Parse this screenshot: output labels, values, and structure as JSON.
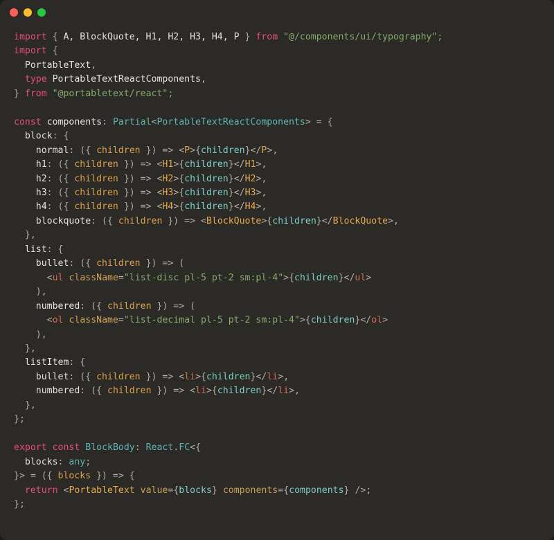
{
  "titlebar": {
    "title": ""
  },
  "code": {
    "line1": {
      "import": "import",
      "lbrace": " { ",
      "items": "A, BlockQuote, H1, H2, H3, H4, P",
      "rbrace": " } ",
      "from": "from",
      "q1": " \"",
      "mod": "@/components/ui/typography",
      "q2": "\";"
    },
    "line2": {
      "import": "import",
      "lbrace": " {"
    },
    "line3": {
      "indent": "  ",
      "name": "PortableText",
      "comma": ","
    },
    "line4": {
      "indent": "  ",
      "typekw": "type",
      "sp": " ",
      "name": "PortableTextReactComponents",
      "comma": ","
    },
    "line5": {
      "rbrace": "} ",
      "from": "from",
      "q1": " \"",
      "mod": "@portabletext/react",
      "q2": "\";"
    },
    "blank1": "",
    "line6": {
      "const": "const",
      "sp": " ",
      "name": "components",
      "colon": ": ",
      "typefn": "Partial",
      "lt": "<",
      "tparam": "PortableTextReactComponents",
      "gt": ">",
      "eq": " = {",
      "end": ""
    },
    "line7": {
      "indent": "  ",
      "key": "block",
      "colon": ": {"
    },
    "line8": {
      "indent": "    ",
      "key": "normal",
      "pre": ": ({ ",
      "param": "children",
      "post": " }) => ",
      "lt": "<",
      "tag": "P",
      "gt": ">",
      "lbrace": "{",
      "expr": "children",
      "rbrace": "}",
      "clt": "</",
      "ctag": "P",
      "cgt": ">",
      "comma": ","
    },
    "line9": {
      "indent": "    ",
      "key": "h1",
      "pre": ": ({ ",
      "param": "children",
      "post": " }) => ",
      "lt": "<",
      "tag": "H1",
      "gt": ">",
      "lbrace": "{",
      "expr": "children",
      "rbrace": "}",
      "clt": "</",
      "ctag": "H1",
      "cgt": ">",
      "comma": ","
    },
    "line10": {
      "indent": "    ",
      "key": "h2",
      "pre": ": ({ ",
      "param": "children",
      "post": " }) => ",
      "lt": "<",
      "tag": "H2",
      "gt": ">",
      "lbrace": "{",
      "expr": "children",
      "rbrace": "}",
      "clt": "</",
      "ctag": "H2",
      "cgt": ">",
      "comma": ","
    },
    "line11": {
      "indent": "    ",
      "key": "h3",
      "pre": ": ({ ",
      "param": "children",
      "post": " }) => ",
      "lt": "<",
      "tag": "H3",
      "gt": ">",
      "lbrace": "{",
      "expr": "children",
      "rbrace": "}",
      "clt": "</",
      "ctag": "H3",
      "cgt": ">",
      "comma": ","
    },
    "line12": {
      "indent": "    ",
      "key": "h4",
      "pre": ": ({ ",
      "param": "children",
      "post": " }) => ",
      "lt": "<",
      "tag": "H4",
      "gt": ">",
      "lbrace": "{",
      "expr": "children",
      "rbrace": "}",
      "clt": "</",
      "ctag": "H4",
      "cgt": ">",
      "comma": ","
    },
    "line13": {
      "indent": "    ",
      "key": "blockquote",
      "pre": ": ({ ",
      "param": "children",
      "post": " }) => ",
      "lt": "<",
      "tag": "BlockQuote",
      "gt": ">",
      "lbrace": "{",
      "expr": "children",
      "rbrace": "}",
      "clt": "</",
      "ctag": "BlockQuote",
      "cgt": ">",
      "comma": ","
    },
    "line14": {
      "indent": "  ",
      "text": "},"
    },
    "line15": {
      "indent": "  ",
      "key": "list",
      "colon": ": {"
    },
    "line16": {
      "indent": "    ",
      "key": "bullet",
      "pre": ": ({ ",
      "param": "children",
      "post": " }) => ("
    },
    "line17": {
      "indent": "      ",
      "lt": "<",
      "tag": "ul",
      "sp": " ",
      "attr": "className",
      "eq": "=",
      "q": "\"",
      "val": "list-disc pl-5 pt-2 sm:pl-4",
      "q2": "\"",
      "gt": ">",
      "lbrace": "{",
      "expr": "children",
      "rbrace": "}",
      "clt": "</",
      "ctag": "ul",
      "cgt": ">"
    },
    "line18": {
      "indent": "    ",
      "text": "),"
    },
    "line19": {
      "indent": "    ",
      "key": "numbered",
      "pre": ": ({ ",
      "param": "children",
      "post": " }) => ("
    },
    "line20": {
      "indent": "      ",
      "lt": "<",
      "tag": "ol",
      "sp": " ",
      "attr": "className",
      "eq": "=",
      "q": "\"",
      "val": "list-decimal pl-5 pt-2 sm:pl-4",
      "q2": "\"",
      "gt": ">",
      "lbrace": "{",
      "expr": "children",
      "rbrace": "}",
      "clt": "</",
      "ctag": "ol",
      "cgt": ">"
    },
    "line21": {
      "indent": "    ",
      "text": "),"
    },
    "line22": {
      "indent": "  ",
      "text": "},"
    },
    "line23": {
      "indent": "  ",
      "key": "listItem",
      "colon": ": {"
    },
    "line24": {
      "indent": "    ",
      "key": "bullet",
      "pre": ": ({ ",
      "param": "children",
      "post": " }) => ",
      "lt": "<",
      "tag": "li",
      "gt": ">",
      "lbrace": "{",
      "expr": "children",
      "rbrace": "}",
      "clt": "</",
      "ctag": "li",
      "cgt": ">",
      "comma": ","
    },
    "line25": {
      "indent": "    ",
      "key": "numbered",
      "pre": ": ({ ",
      "param": "children",
      "post": " }) => ",
      "lt": "<",
      "tag": "li",
      "gt": ">",
      "lbrace": "{",
      "expr": "children",
      "rbrace": "}",
      "clt": "</",
      "ctag": "li",
      "cgt": ">",
      "comma": ","
    },
    "line26": {
      "indent": "  ",
      "text": "},"
    },
    "line27": {
      "text": "};"
    },
    "blank2": "",
    "line28": {
      "export": "export",
      "sp": " ",
      "const": "const",
      "sp2": " ",
      "name": "BlockBody",
      "colon": ": ",
      "react": "React",
      "dot": ".",
      "fc": "FC",
      "lt": "<{",
      "end": ""
    },
    "line29": {
      "indent": "  ",
      "key": "blocks",
      "colon": ": ",
      "type": "any",
      "semi": ";"
    },
    "line30": {
      "rbrace": "}> = ({ ",
      "param": "blocks",
      "post": " }) => {"
    },
    "line31": {
      "indent": "  ",
      "return": "return",
      "sp": " ",
      "lt": "<",
      "tag": "PortableText",
      "sp2": " ",
      "attr1": "value",
      "eq1": "=",
      "lb1": "{",
      "v1": "blocks",
      "rb1": "}",
      "sp3": " ",
      "attr2": "components",
      "eq2": "=",
      "lb2": "{",
      "v2": "components",
      "rb2": "}",
      "close": " />",
      "semi": ";"
    },
    "line32": {
      "text": "};"
    }
  }
}
